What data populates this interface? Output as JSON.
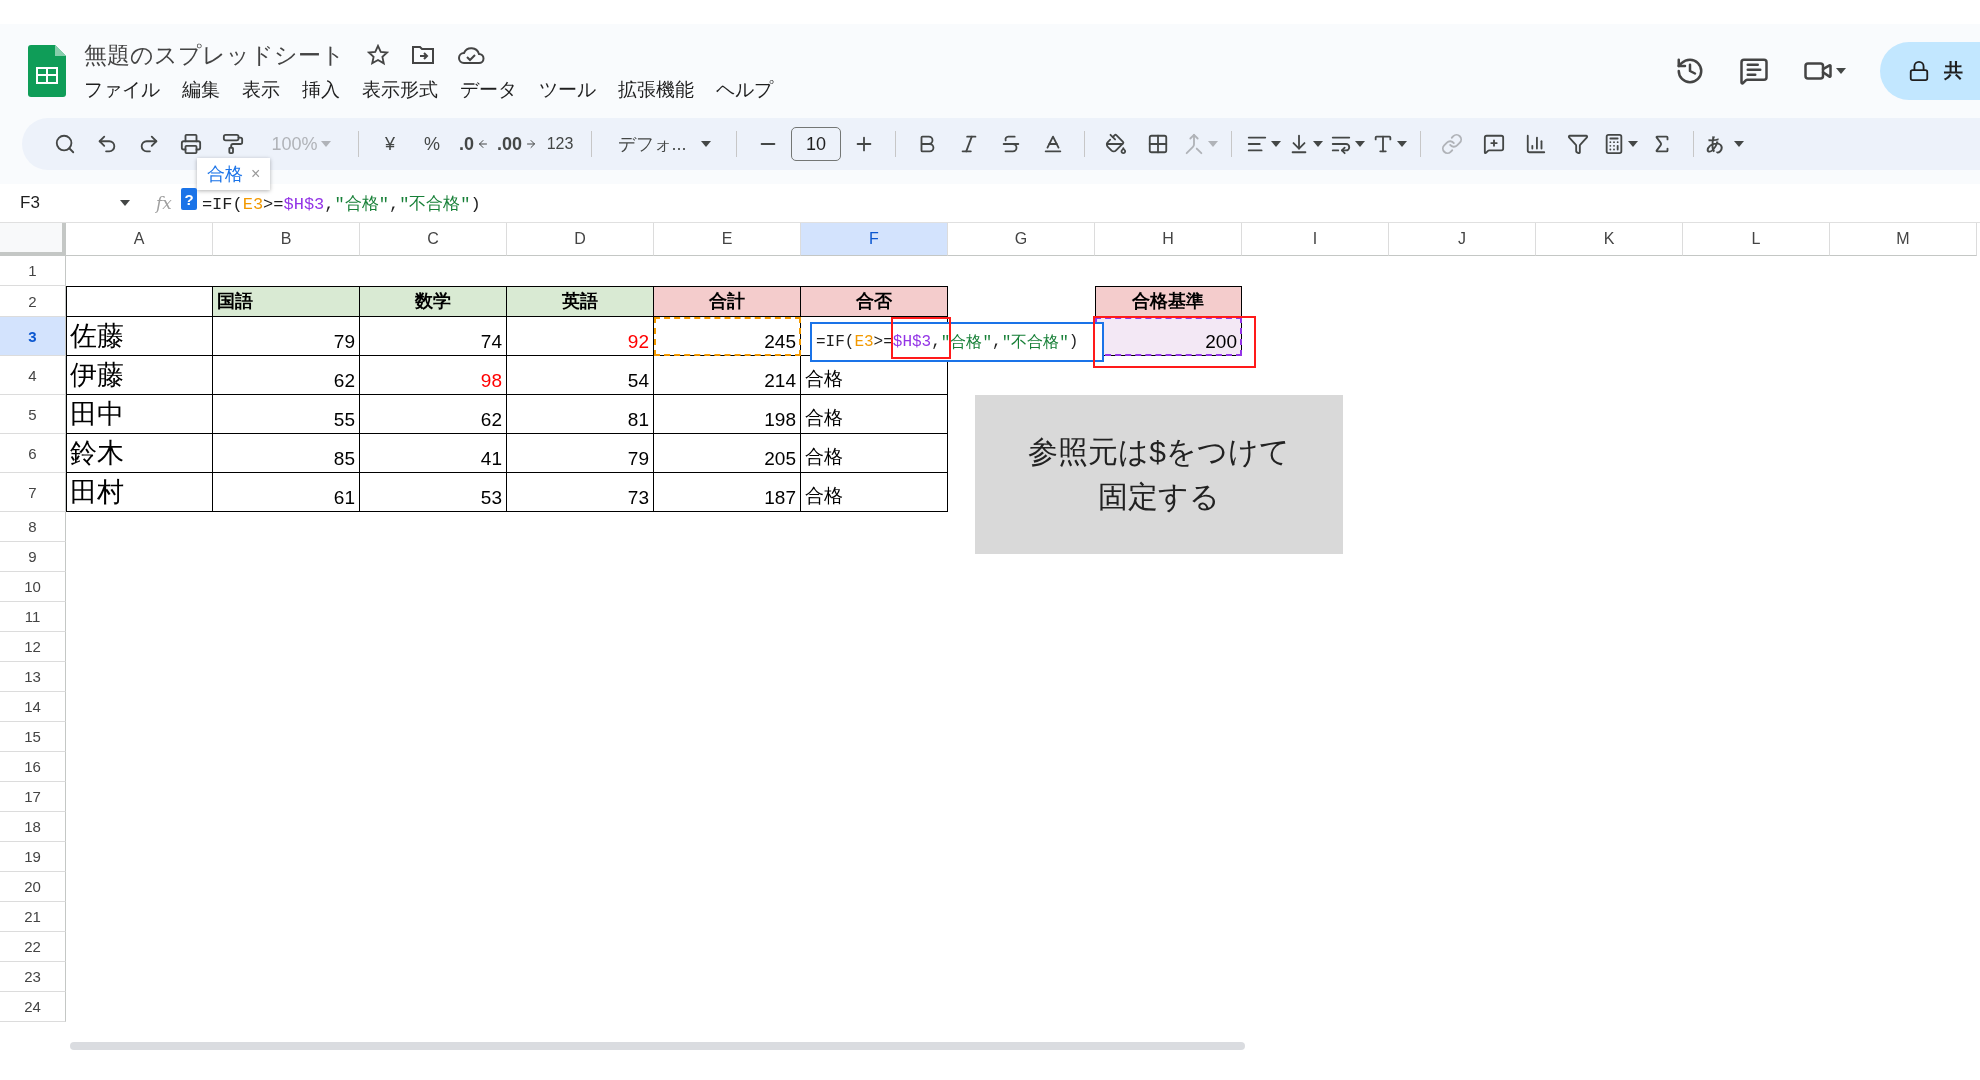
{
  "app": {
    "title": "無題のスプレッドシート",
    "share_label": "共"
  },
  "menu": [
    "ファイル",
    "編集",
    "表示",
    "挿入",
    "表示形式",
    "データ",
    "ツール",
    "拡張機能",
    "ヘルプ"
  ],
  "toolbar": {
    "zoom": {
      "label": "100%",
      "disabled": true
    },
    "currency": "¥",
    "percent": "%",
    "decimal_decrease": ".0",
    "decimal_increase": ".00",
    "number_format": "123",
    "font": "デフォ...",
    "font_size": "10",
    "merge": {
      "disabled": true
    },
    "link": {
      "disabled": true
    },
    "input_mode": "あ"
  },
  "suggestion_chip": {
    "label": "合格",
    "close": "×"
  },
  "help_badge": "?",
  "formula_bar": {
    "name_box": "F3",
    "fx_label": "fx",
    "parts": [
      {
        "text": "=IF(",
        "kind": "plain"
      },
      {
        "text": "E3",
        "kind": "ref_a"
      },
      {
        "text": ">=",
        "kind": "plain"
      },
      {
        "text": "$H$3",
        "kind": "ref_b"
      },
      {
        "text": ",",
        "kind": "plain"
      },
      {
        "text": "\"合格\"",
        "kind": "string"
      },
      {
        "text": ",",
        "kind": "plain"
      },
      {
        "text": "\"不合格\"",
        "kind": "string"
      },
      {
        "text": ")",
        "kind": "plain"
      }
    ]
  },
  "cell_editor": {
    "parts": [
      {
        "text": "=IF(",
        "kind": "plain"
      },
      {
        "text": "E3",
        "kind": "ref_a"
      },
      {
        "text": ">=",
        "kind": "plain"
      },
      {
        "text": "$H$3",
        "kind": "ref_b"
      },
      {
        "text": ",",
        "kind": "plain"
      },
      {
        "text": "\"合格\"",
        "kind": "string"
      },
      {
        "text": ",",
        "kind": "plain"
      },
      {
        "text": "\"不合格\"",
        "kind": "string"
      },
      {
        "text": ")",
        "kind": "plain"
      }
    ]
  },
  "sheet": {
    "columns": [
      {
        "label": "A",
        "selected": false
      },
      {
        "label": "B",
        "selected": false
      },
      {
        "label": "C",
        "selected": false
      },
      {
        "label": "D",
        "selected": false
      },
      {
        "label": "E",
        "selected": false
      },
      {
        "label": "F",
        "selected": true
      },
      {
        "label": "G",
        "selected": false
      },
      {
        "label": "H",
        "selected": false
      },
      {
        "label": "I",
        "selected": false
      },
      {
        "label": "J",
        "selected": false
      },
      {
        "label": "K",
        "selected": false
      },
      {
        "label": "L",
        "selected": false
      },
      {
        "label": "M",
        "selected": false
      }
    ],
    "rows": [
      {
        "label": "1",
        "selected": false
      },
      {
        "label": "2",
        "selected": false
      },
      {
        "label": "3",
        "selected": true
      },
      {
        "label": "4",
        "selected": false
      },
      {
        "label": "5",
        "selected": false
      },
      {
        "label": "6",
        "selected": false
      },
      {
        "label": "7",
        "selected": false
      },
      {
        "label": "8",
        "selected": false
      },
      {
        "label": "9",
        "selected": false
      },
      {
        "label": "10",
        "selected": false
      },
      {
        "label": "11",
        "selected": false
      },
      {
        "label": "12",
        "selected": false
      },
      {
        "label": "13",
        "selected": false
      },
      {
        "label": "14",
        "selected": false
      },
      {
        "label": "15",
        "selected": false
      },
      {
        "label": "16",
        "selected": false
      },
      {
        "label": "17",
        "selected": false
      },
      {
        "label": "18",
        "selected": false
      },
      {
        "label": "19",
        "selected": false
      },
      {
        "label": "20",
        "selected": false
      },
      {
        "label": "21",
        "selected": false
      },
      {
        "label": "22",
        "selected": false
      },
      {
        "label": "23",
        "selected": false
      },
      {
        "label": "24",
        "selected": false
      }
    ]
  },
  "score_table": {
    "headers": [
      {
        "text": "国語",
        "color": "#d9ead3"
      },
      {
        "text": "数学",
        "color": "#d9ead3"
      },
      {
        "text": "英語",
        "color": "#d9ead3"
      },
      {
        "text": "合計",
        "color": "#f4cccc"
      },
      {
        "text": "合否",
        "color": "#f4cccc"
      }
    ],
    "rows": [
      {
        "name": "佐藤",
        "scores": [
          {
            "value": "79",
            "highlight": false
          },
          {
            "value": "74",
            "highlight": false
          },
          {
            "value": "92",
            "highlight": true
          }
        ],
        "total": "245",
        "referenced": true
      },
      {
        "name": "伊藤",
        "scores": [
          {
            "value": "62",
            "highlight": false
          },
          {
            "value": "98",
            "highlight": true
          },
          {
            "value": "54",
            "highlight": false
          }
        ],
        "total": "214",
        "referenced": false,
        "result": "合格"
      },
      {
        "name": "田中",
        "scores": [
          {
            "value": "55",
            "highlight": false
          },
          {
            "value": "62",
            "highlight": false
          },
          {
            "value": "81",
            "highlight": false
          }
        ],
        "total": "198",
        "referenced": false,
        "result": "合格"
      },
      {
        "name": "鈴木",
        "scores": [
          {
            "value": "85",
            "highlight": false
          },
          {
            "value": "41",
            "highlight": false
          },
          {
            "value": "79",
            "highlight": false
          }
        ],
        "total": "205",
        "referenced": false,
        "result": "合格"
      },
      {
        "name": "田村",
        "scores": [
          {
            "value": "61",
            "highlight": false
          },
          {
            "value": "53",
            "highlight": false
          },
          {
            "value": "73",
            "highlight": false
          }
        ],
        "total": "187",
        "referenced": false,
        "result": "合格"
      }
    ]
  },
  "criteria": {
    "header": "合格基準",
    "color": "#f4cccc",
    "value": "200",
    "referenced": true
  },
  "note": {
    "lines": [
      "参照元は$をつけて",
      "固定する"
    ]
  }
}
